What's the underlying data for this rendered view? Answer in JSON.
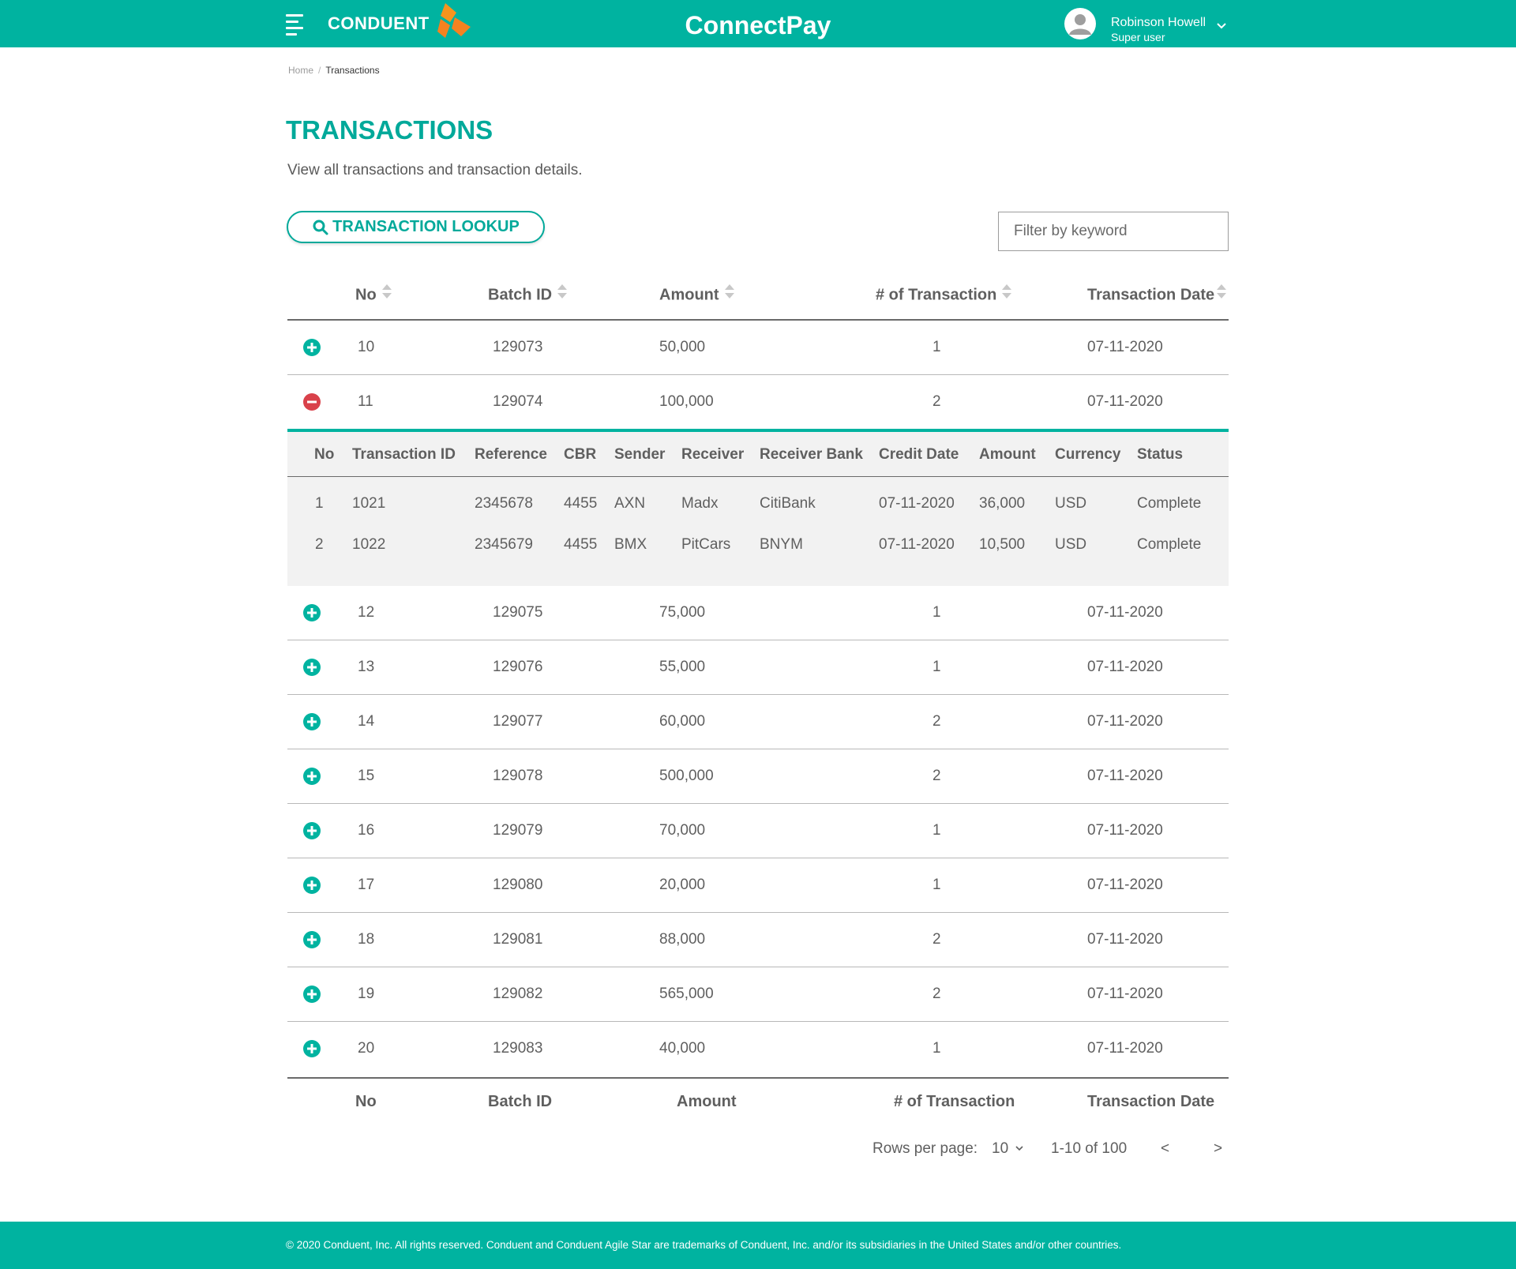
{
  "header": {
    "brand": "CONDUENT",
    "app_title": "ConnectPay",
    "user_name": "Robinson Howell",
    "user_role": "Super  user",
    "icons": [
      "menu-icon",
      "conduent-logo-icon",
      "user-avatar-icon",
      "chevron-down-icon"
    ],
    "colors": {
      "primary": "#00b3a0",
      "logo_orange": "#f5821f"
    }
  },
  "breadcrumb": {
    "home": "Home",
    "separator": "/",
    "current": "Transactions"
  },
  "page": {
    "title": "TRANSACTIONS",
    "description": "View all transactions and transaction details.",
    "lookup_button": "TRANSACTION LOOKUP",
    "filter_placeholder": "Filter by keyword"
  },
  "table": {
    "columns": [
      "No",
      "Batch ID",
      "Amount",
      "# of Transaction",
      "Transaction Date"
    ],
    "rows": [
      {
        "no": "10",
        "batch_id": "129073",
        "amount": "50,000",
        "count": "1",
        "date": "07-11-2020",
        "expanded": false
      },
      {
        "no": "11",
        "batch_id": "129074",
        "amount": "100,000",
        "count": "2",
        "date": "07-11-2020",
        "expanded": true
      },
      {
        "no": "12",
        "batch_id": "129075",
        "amount": "75,000",
        "count": "1",
        "date": "07-11-2020",
        "expanded": false
      },
      {
        "no": "13",
        "batch_id": "129076",
        "amount": "55,000",
        "count": "1",
        "date": "07-11-2020",
        "expanded": false
      },
      {
        "no": "14",
        "batch_id": "129077",
        "amount": "60,000",
        "count": "2",
        "date": "07-11-2020",
        "expanded": false
      },
      {
        "no": "15",
        "batch_id": "129078",
        "amount": "500,000",
        "count": "2",
        "date": "07-11-2020",
        "expanded": false
      },
      {
        "no": "16",
        "batch_id": "129079",
        "amount": "70,000",
        "count": "1",
        "date": "07-11-2020",
        "expanded": false
      },
      {
        "no": "17",
        "batch_id": "129080",
        "amount": "20,000",
        "count": "1",
        "date": "07-11-2020",
        "expanded": false
      },
      {
        "no": "18",
        "batch_id": "129081",
        "amount": "88,000",
        "count": "2",
        "date": "07-11-2020",
        "expanded": false
      },
      {
        "no": "19",
        "batch_id": "129082",
        "amount": "565,000",
        "count": "2",
        "date": "07-11-2020",
        "expanded": false
      },
      {
        "no": "20",
        "batch_id": "129083",
        "amount": "40,000",
        "count": "1",
        "date": "07-11-2020",
        "expanded": false
      }
    ],
    "detail": {
      "columns": [
        "No",
        "Transaction ID",
        "Reference",
        "CBR",
        "Sender",
        "Receiver",
        "Receiver Bank",
        "Credit Date",
        "Amount",
        "Currency",
        "Status"
      ],
      "rows": [
        [
          "1",
          "1021",
          "2345678",
          "4455",
          "AXN",
          "Madx",
          "CitiBank",
          "07-11-2020",
          "36,000",
          "USD",
          "Complete"
        ],
        [
          "2",
          "1022",
          "2345679",
          "4455",
          "BMX",
          "PitCars",
          "BNYM",
          "07-11-2020",
          "10,500",
          "USD",
          "Complete"
        ]
      ]
    },
    "footer_columns": [
      "No",
      "Batch ID",
      "Amount",
      "# of Transaction",
      "Transaction Date"
    ],
    "colors": {
      "expand": "#00b3a0",
      "collapse": "#d9414a"
    }
  },
  "pagination": {
    "rows_label": "Rows per page:",
    "rows_value": "10",
    "range": "1-10 of 100",
    "prev": "<",
    "next": ">"
  },
  "footer": {
    "copyright": "© 2020 Conduent, Inc. All rights reserved. Conduent and Conduent Agile Star are trademarks of Conduent, Inc. and/or its subsidiaries in the United States and/or other countries."
  }
}
